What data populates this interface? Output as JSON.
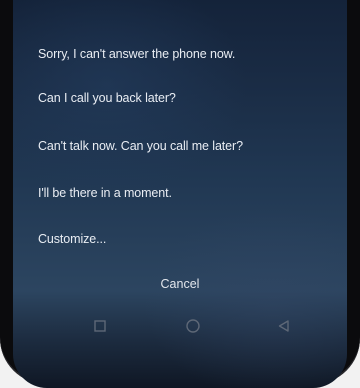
{
  "quick_replies": {
    "items": [
      {
        "label": "Sorry, I can't answer the phone now."
      },
      {
        "label": "Can I call you back later?"
      },
      {
        "label": "Can't talk now. Can you call me later?"
      },
      {
        "label": "I'll be there in a moment."
      },
      {
        "label": "Customize..."
      }
    ],
    "cancel_label": "Cancel"
  },
  "navigation_bar": {
    "buttons": [
      {
        "icon": "square-recents-icon"
      },
      {
        "icon": "circle-home-icon"
      },
      {
        "icon": "triangle-back-icon"
      }
    ]
  },
  "colors": {
    "text": "#e9edf3",
    "icon": "#6f7a88",
    "background_top": "#14233a",
    "background_bottom": "#0f1724"
  }
}
